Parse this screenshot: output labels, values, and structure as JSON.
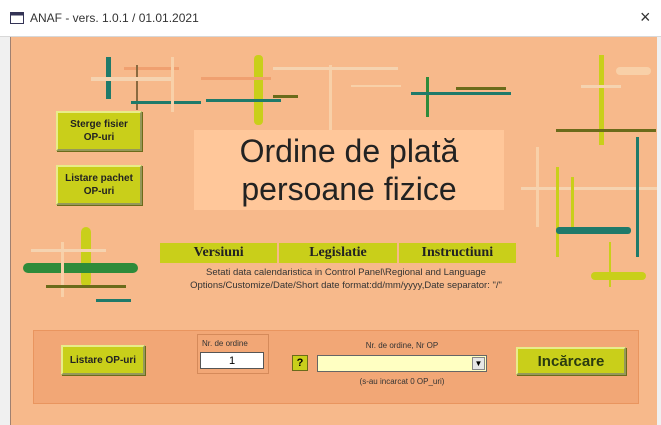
{
  "window": {
    "title": "ANAF - vers. 1.0.1  / 01.01.2021",
    "close_glyph": "×"
  },
  "buttons": {
    "sterge": "Sterge fisier\nOP-uri",
    "listare_pachet": "Listare pachet\nOP-uri",
    "listare_op": "Listare OP-uri",
    "incarcare": "Incărcare",
    "help": "?"
  },
  "heading": "Ordine de plată\npersoane fizice",
  "nav": [
    "Versiuni",
    "Legislatie",
    "Instructiuni"
  ],
  "note": "Setati data calendaristica in Control Panel\\Regional and Language Options/Customize/Date/Short date format:dd/mm/yyyy,Date separator: \"/\"",
  "panel": {
    "nr_ordine_label": "Nr. de ordine",
    "nr_ordine_value": "1",
    "select_label": "Nr. de ordine, Nr OP",
    "select_value": "",
    "status": "(s-au incarcat 0 OP_uri)"
  },
  "colors": {
    "background": "#f7b98b",
    "accent_olive": "#c9cf1a",
    "panel": "#f2a776",
    "teal": "#1f7a6a",
    "green": "#2e8b3a"
  },
  "icons": {
    "app": "window-app-icon",
    "dropdown": "chevron-down-icon"
  }
}
